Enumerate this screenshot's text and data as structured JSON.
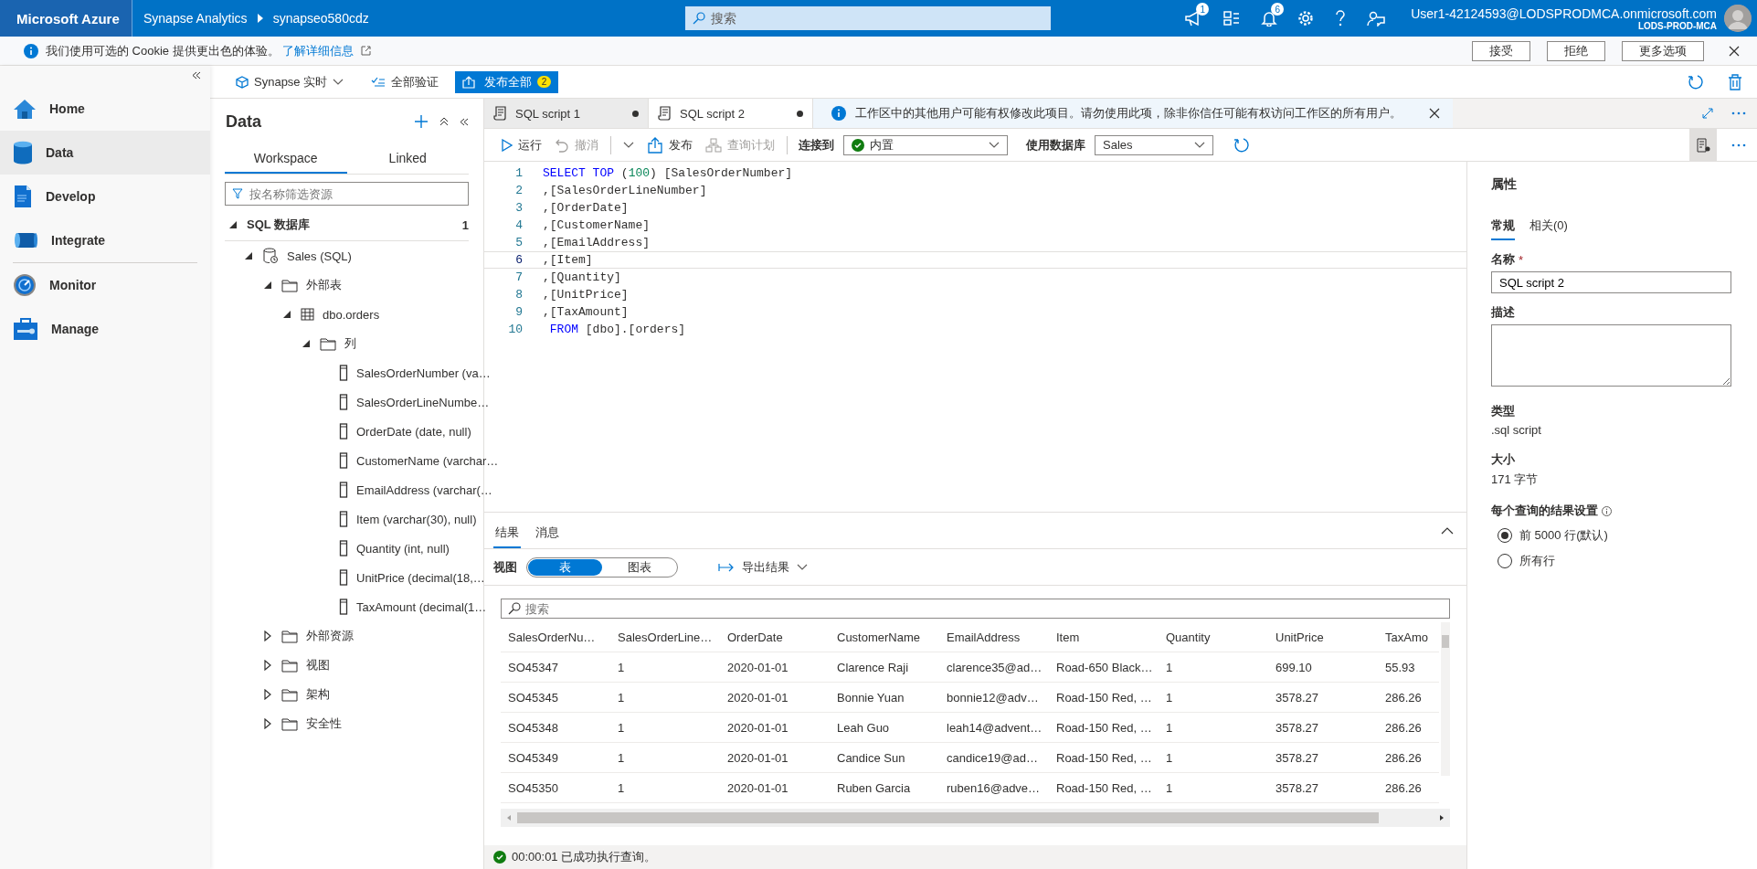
{
  "top_bar": {
    "brand": "Microsoft Azure",
    "breadcrumb": [
      "Synapse Analytics",
      "synapseo580cdz"
    ],
    "search": {
      "placeholder": "搜索"
    },
    "icons": [
      {
        "kind": "feedback",
        "count": "1"
      },
      {
        "kind": "directory"
      },
      {
        "kind": "notifications",
        "count": "6"
      },
      {
        "kind": "settings"
      },
      {
        "kind": "help"
      },
      {
        "kind": "support"
      }
    ],
    "user": {
      "email": "User1-42124593@LODSPRODMCA.onmicrosoft.com",
      "tenant": "LODS-PROD-MCA"
    }
  },
  "cookie_banner": {
    "text": "我们使用可选的 Cookie 提供更出色的体验。",
    "link": "了解详细信息",
    "buttons": [
      "接受",
      "拒绝",
      "更多选项"
    ]
  },
  "nav": {
    "items": [
      {
        "label": "Home",
        "kind": "home",
        "selected": false
      },
      {
        "label": "Data",
        "kind": "data",
        "selected": true
      },
      {
        "label": "Develop",
        "kind": "develop",
        "selected": false
      },
      {
        "label": "Integrate",
        "kind": "integrate",
        "selected": false
      },
      {
        "label": "Monitor",
        "kind": "monitor",
        "selected": false
      },
      {
        "label": "Manage",
        "kind": "manage",
        "selected": false
      }
    ]
  },
  "toolbar": {
    "live_mode": "Synapse 实时",
    "validate": "全部验证",
    "publish": {
      "label": "发布全部",
      "count": "2"
    }
  },
  "data_panel": {
    "title": "Data",
    "tabs": [
      {
        "label": "Workspace",
        "selected": true
      },
      {
        "label": "Linked",
        "selected": false
      }
    ],
    "filter": {
      "placeholder": "按名称筛选资源"
    },
    "section": {
      "label": "SQL 数据库",
      "count": "1",
      "expanded": true
    },
    "tree": [
      {
        "label": "Sales (SQL)",
        "kind": "database",
        "expanded": true,
        "children": [
          {
            "label": "外部表",
            "kind": "folder",
            "expanded": true,
            "children": [
              {
                "label": "dbo.orders",
                "kind": "table",
                "expanded": true,
                "children": [
                  {
                    "label": "列",
                    "kind": "folder",
                    "expanded": true,
                    "children": [
                      {
                        "label": "SalesOrderNumber (va…",
                        "kind": "column"
                      },
                      {
                        "label": "SalesOrderLineNumbe…",
                        "kind": "column"
                      },
                      {
                        "label": "OrderDate (date, null)",
                        "kind": "column"
                      },
                      {
                        "label": "CustomerName (varchar…",
                        "kind": "column"
                      },
                      {
                        "label": "EmailAddress (varchar(…",
                        "kind": "column"
                      },
                      {
                        "label": "Item (varchar(30), null)",
                        "kind": "column"
                      },
                      {
                        "label": "Quantity (int, null)",
                        "kind": "column"
                      },
                      {
                        "label": "UnitPrice (decimal(18,…",
                        "kind": "column"
                      },
                      {
                        "label": "TaxAmount (decimal(1…",
                        "kind": "column"
                      }
                    ]
                  }
                ]
              }
            ]
          },
          {
            "label": "外部资源",
            "kind": "folder",
            "expanded": false
          },
          {
            "label": "视图",
            "kind": "folder",
            "expanded": false
          },
          {
            "label": "架构",
            "kind": "folder",
            "expanded": false
          },
          {
            "label": "安全性",
            "kind": "folder",
            "expanded": false
          }
        ]
      }
    ]
  },
  "editor_tabs": [
    {
      "label": "SQL script 1",
      "selected": false,
      "modified": true
    },
    {
      "label": "SQL script 2",
      "selected": true,
      "modified": true
    }
  ],
  "notice": "工作区中的其他用户可能有权修改此项目。请勿使用此项，除非你信任可能有权访问工作区的所有用户。",
  "editor_toolbar": {
    "actions": [
      {
        "kind": "run",
        "label": "运行",
        "disabled": false
      },
      {
        "kind": "undo",
        "label": "撤消",
        "disabled": true
      },
      {
        "kind": "more",
        "disabled": false
      },
      {
        "kind": "publish",
        "label": "发布",
        "disabled": false
      },
      {
        "kind": "plan",
        "label": "查询计划",
        "disabled": true
      }
    ],
    "connect": {
      "label": "连接到",
      "value": "内置"
    },
    "database": {
      "label": "使用数据库",
      "value": "Sales"
    }
  },
  "code": [
    {
      "number": "1",
      "current": false,
      "tokens": [
        {
          "kind": "keyword",
          "text": "SELECT TOP"
        },
        {
          "kind": "plain",
          "text": " ("
        },
        {
          "kind": "number",
          "text": "100"
        },
        {
          "kind": "plain",
          "text": ") [SalesOrderNumber]"
        }
      ]
    },
    {
      "number": "2",
      "current": false,
      "tokens": [
        {
          "kind": "plain",
          "text": ",[SalesOrderLineNumber]"
        }
      ]
    },
    {
      "number": "3",
      "current": false,
      "tokens": [
        {
          "kind": "plain",
          "text": ",[OrderDate]"
        }
      ]
    },
    {
      "number": "4",
      "current": false,
      "tokens": [
        {
          "kind": "plain",
          "text": ",[CustomerName]"
        }
      ]
    },
    {
      "number": "5",
      "current": false,
      "tokens": [
        {
          "kind": "plain",
          "text": ",[EmailAddress]"
        }
      ]
    },
    {
      "number": "6",
      "current": true,
      "tokens": [
        {
          "kind": "plain",
          "text": ",[Item]"
        }
      ]
    },
    {
      "number": "7",
      "current": false,
      "tokens": [
        {
          "kind": "plain",
          "text": ",[Quantity]"
        }
      ]
    },
    {
      "number": "8",
      "current": false,
      "tokens": [
        {
          "kind": "plain",
          "text": ",[UnitPrice]"
        }
      ]
    },
    {
      "number": "9",
      "current": false,
      "tokens": [
        {
          "kind": "plain",
          "text": ",[TaxAmount]"
        }
      ]
    },
    {
      "number": "10",
      "current": false,
      "tokens": [
        {
          "kind": "keyword",
          "text": " FROM"
        },
        {
          "kind": "plain",
          "text": " [dbo].[orders]"
        }
      ]
    }
  ],
  "results": {
    "tabs": [
      {
        "label": "结果",
        "selected": true
      },
      {
        "label": "消息",
        "selected": false
      }
    ],
    "view_label": "视图",
    "view_options": [
      {
        "label": "表",
        "selected": true
      },
      {
        "label": "图表",
        "selected": false
      }
    ],
    "export": "导出结果",
    "search": {
      "placeholder": "搜索"
    },
    "table": {
      "columns": [
        "SalesOrderNu…",
        "SalesOrderLine…",
        "OrderDate",
        "CustomerName",
        "EmailAddress",
        "Item",
        "Quantity",
        "UnitPrice",
        "TaxAmo"
      ],
      "rows": [
        [
          "SO45347",
          "1",
          "2020-01-01",
          "Clarence Raji",
          "clarence35@ad…",
          "Road-650 Black…",
          "1",
          "699.10",
          "55.93"
        ],
        [
          "SO45345",
          "1",
          "2020-01-01",
          "Bonnie Yuan",
          "bonnie12@adv…",
          "Road-150 Red, …",
          "1",
          "3578.27",
          "286.26"
        ],
        [
          "SO45348",
          "1",
          "2020-01-01",
          "Leah Guo",
          "leah14@advent…",
          "Road-150 Red, …",
          "1",
          "3578.27",
          "286.26"
        ],
        [
          "SO45349",
          "1",
          "2020-01-01",
          "Candice Sun",
          "candice19@ad…",
          "Road-150 Red, …",
          "1",
          "3578.27",
          "286.26"
        ],
        [
          "SO45350",
          "1",
          "2020-01-01",
          "Ruben Garcia",
          "ruben16@adve…",
          "Road-150 Red, …",
          "1",
          "3578.27",
          "286.26"
        ]
      ]
    }
  },
  "status": "00:00:01 已成功执行查询。",
  "properties": {
    "title": "属性",
    "tabs": [
      {
        "label": "常规",
        "selected": true
      },
      {
        "label": "相关(0)",
        "selected": false
      }
    ],
    "name_label": "名称",
    "required_mark": "*",
    "name_value": "SQL script 2",
    "description_label": "描述",
    "type_label": "类型",
    "type_value": ".sql script",
    "size_label": "大小",
    "size_value": "171 字节",
    "result_label": "每个查询的结果设置",
    "options": [
      {
        "label": "前 5000 行(默认)",
        "selected": true
      },
      {
        "label": "所有行",
        "selected": false
      }
    ]
  }
}
